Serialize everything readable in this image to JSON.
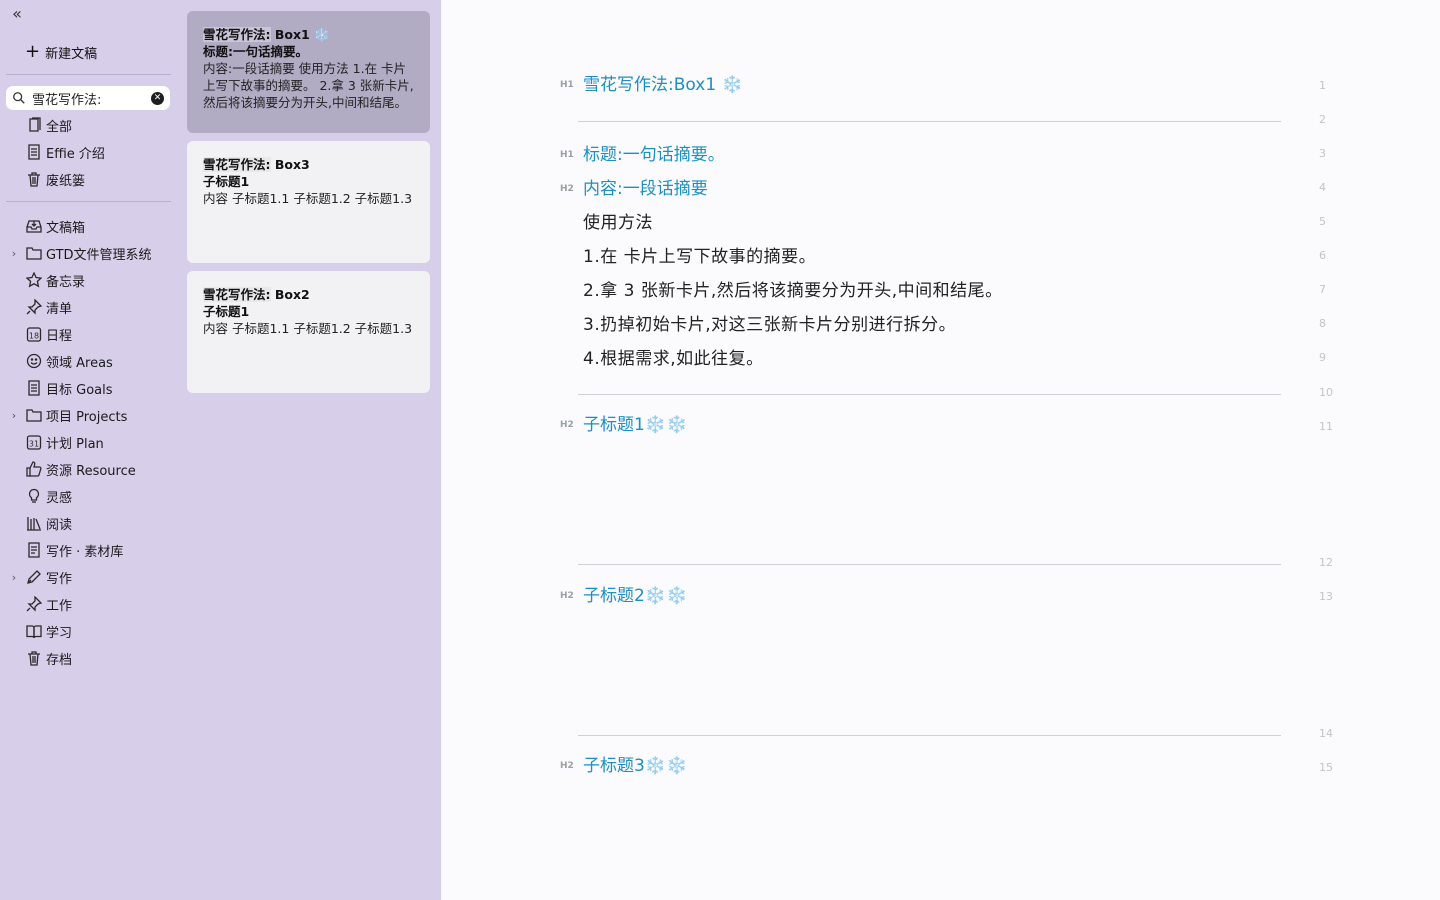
{
  "sidebar": {
    "new_doc": "新建文稿",
    "search": {
      "value": "雪花写作法:"
    },
    "items": [
      {
        "label": "全部",
        "icon": "all-docs-icon"
      },
      {
        "label": "Effie 介绍",
        "icon": "document-icon"
      },
      {
        "label": "废纸篓",
        "icon": "trash-icon"
      },
      {
        "label": "文稿箱",
        "icon": "inbox-icon"
      },
      {
        "label": "GTD文件管理系统",
        "icon": "folder-icon"
      },
      {
        "label": "备忘录",
        "icon": "star-icon"
      },
      {
        "label": "清单",
        "icon": "pin-icon"
      },
      {
        "label": "日程",
        "icon": "calendar-icon"
      },
      {
        "label": "领域 Areas",
        "icon": "smiley-icon"
      },
      {
        "label": "目标 Goals",
        "icon": "document-icon"
      },
      {
        "label": "项目 Projects",
        "icon": "folder-icon"
      },
      {
        "label": "计划 Plan",
        "icon": "calendar-icon"
      },
      {
        "label": "资源 Resource",
        "icon": "thumbs-up-icon"
      },
      {
        "label": "灵感",
        "icon": "lightbulb-icon"
      },
      {
        "label": "阅读",
        "icon": "books-icon"
      },
      {
        "label": "写作 · 素材库",
        "icon": "notes-icon"
      },
      {
        "label": "写作",
        "icon": "pen-icon"
      },
      {
        "label": "工作",
        "icon": "pin-icon"
      },
      {
        "label": "学习",
        "icon": "open-book-icon"
      },
      {
        "label": "存档",
        "icon": "trash-icon"
      }
    ]
  },
  "cards": [
    {
      "title_hl": "雪花写作法:",
      "title_rest": "Box1 ❄️",
      "subtitle": "标题:一句话摘要。",
      "body": "内容:一段话摘要 使用方法 1.在 卡片上写下故事的摘要。 2.拿 3 张新卡片,然后将该摘要分为开头,中间和结尾。"
    },
    {
      "title_hl": "雪花写作法:",
      "title_rest": "Box3",
      "subtitle": "子标题1",
      "body": "内容 子标题1.1 子标题1.2 子标题1.3"
    },
    {
      "title_hl": "雪花写作法:",
      "title_rest": "Box2",
      "subtitle": "子标题1",
      "body": "内容 子标题1.1 子标题1.2 子标题1.3"
    }
  ],
  "editor": {
    "lines": [
      {
        "n": "1",
        "tag": "H1",
        "text": "雪花写作法:Box1 ❄️"
      },
      {
        "n": "2",
        "tag": "",
        "text": ""
      },
      {
        "n": "3",
        "tag": "H1",
        "text": "标题:一句话摘要。"
      },
      {
        "n": "4",
        "tag": "H2",
        "text": "内容:一段话摘要"
      },
      {
        "n": "5",
        "tag": "",
        "text": "使用方法"
      },
      {
        "n": "6",
        "tag": "",
        "text": "1.在 卡片上写下故事的摘要。"
      },
      {
        "n": "7",
        "tag": "",
        "text": "2.拿 3 张新卡片,然后将该摘要分为开头,中间和结尾。"
      },
      {
        "n": "8",
        "tag": "",
        "text": "3.扔掉初始卡片,对这三张新卡片分别进行拆分。"
      },
      {
        "n": "9",
        "tag": "",
        "text": "4.根据需求,如此往复。"
      },
      {
        "n": "10",
        "tag": "",
        "text": ""
      },
      {
        "n": "11",
        "tag": "H2",
        "text": "子标题1❄️❄️"
      },
      {
        "n": "12",
        "tag": "",
        "text": ""
      },
      {
        "n": "13",
        "tag": "H2",
        "text": "子标题2❄️❄️"
      },
      {
        "n": "14",
        "tag": "",
        "text": ""
      },
      {
        "n": "15",
        "tag": "H2",
        "text": "子标题3❄️❄️"
      }
    ]
  },
  "colors": {
    "sidebar_bg": "#d7ceea",
    "heading": "#1c8fc2",
    "selected_card": "#b1abc4"
  }
}
